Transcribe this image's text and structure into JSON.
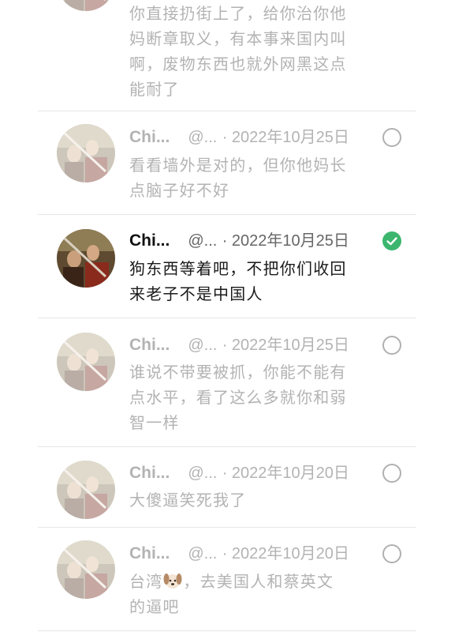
{
  "feed": {
    "colors": {
      "selected": "#3cb66e",
      "unselected_ring": "#b0b0b0",
      "dim_text": "#b3b3b3",
      "text": "#1a1a1a"
    },
    "tweets": [
      {
        "name": "",
        "handle": "",
        "date": "",
        "text": "你直接扔街上了，给你治你他\n妈断章取义，有本事来国内叫\n啊，废物东西也就外网黑这点\n能耐了",
        "selected": false
      },
      {
        "name": "Chi...",
        "handle": "@...",
        "date": "· 2022年10月25日",
        "text": "看看墙外是对的，但你他妈长\n点脑子好不好",
        "selected": false
      },
      {
        "name": "Chi...",
        "handle": "@...",
        "date": "· 2022年10月25日",
        "text": "狗东西等着吧，不把你们收回\n来老子不是中国人",
        "selected": true
      },
      {
        "name": "Chi...",
        "handle": "@...",
        "date": "· 2022年10月25日",
        "text": "谁说不带要被抓，你能不能有\n点水平，看了这么多就你和弱\n智一样",
        "selected": false
      },
      {
        "name": "Chi...",
        "handle": "@...",
        "date": "· 2022年10月20日",
        "text": "大傻逼笑死我了",
        "selected": false
      },
      {
        "name": "Chi...",
        "handle": "@...",
        "date": "· 2022年10月20日",
        "text_before_emoji": "台湾",
        "emoji": "dog-face-emoji",
        "text_after_emoji": "，去美国人和蔡英文\n的逼吧",
        "selected": false
      }
    ]
  }
}
